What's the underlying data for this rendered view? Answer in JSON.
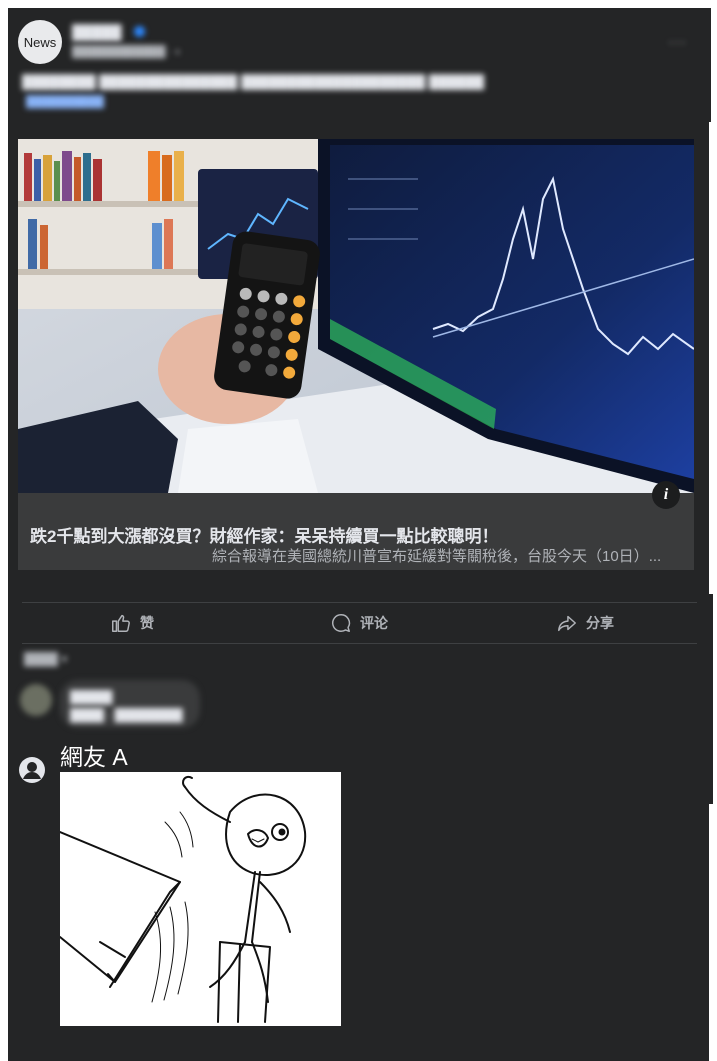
{
  "post": {
    "avatar_text": "News",
    "page_name": "█████",
    "meta": "████████████ · ◐",
    "more": "···",
    "text": "████████ ███████████████ ████████████████████ ██████",
    "tag": "██████████"
  },
  "link_card": {
    "headline": "跌2千點到大漲都沒買？財經作家：呆呆持續買一點比較聰明！",
    "snippet": "綜合報導在美國總統川普宣布延緩對等關稅後，台股今天（10日）...",
    "info_icon": "i"
  },
  "actions": {
    "like_label": "赞",
    "comment_label": "评论",
    "share_label": "分享"
  },
  "comments": {
    "sort_label": "████ ▾",
    "first": {
      "name": "█████",
      "text": "████ · ████████"
    },
    "second": {
      "name": "網友 A"
    }
  }
}
